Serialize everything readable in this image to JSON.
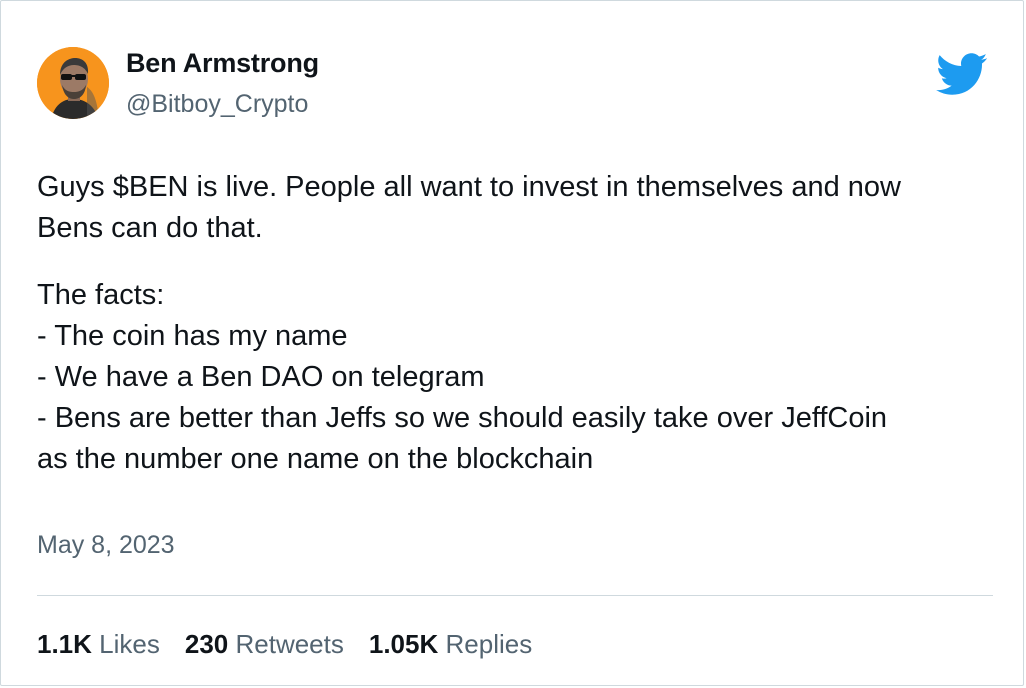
{
  "author": {
    "display_name": "Ben Armstrong",
    "handle": "@Bitboy_Crypto"
  },
  "tweet": {
    "para1_line1": "Guys $BEN is live. People all want to invest in themselves and now",
    "para1_line2": "Bens can do that.",
    "facts_heading": "The facts:",
    "fact1": "- The coin has my name",
    "fact2": "- We have a Ben DAO on telegram",
    "fact3_line1": "- Bens are better than Jeffs so we should easily take over JeffCoin",
    "fact3_line2": "as the number one name on the blockchain"
  },
  "date": "May 8, 2023",
  "stats": {
    "likes_count": "1.1K",
    "likes_label": "Likes",
    "retweets_count": "230",
    "retweets_label": "Retweets",
    "replies_count": "1.05K",
    "replies_label": "Replies"
  },
  "colors": {
    "twitter_blue": "#1d9bf0",
    "avatar_bg": "#f7941d",
    "secondary_text": "#536471",
    "divider": "#cfd9de"
  },
  "icons": {
    "logo": "twitter-bird-icon"
  }
}
